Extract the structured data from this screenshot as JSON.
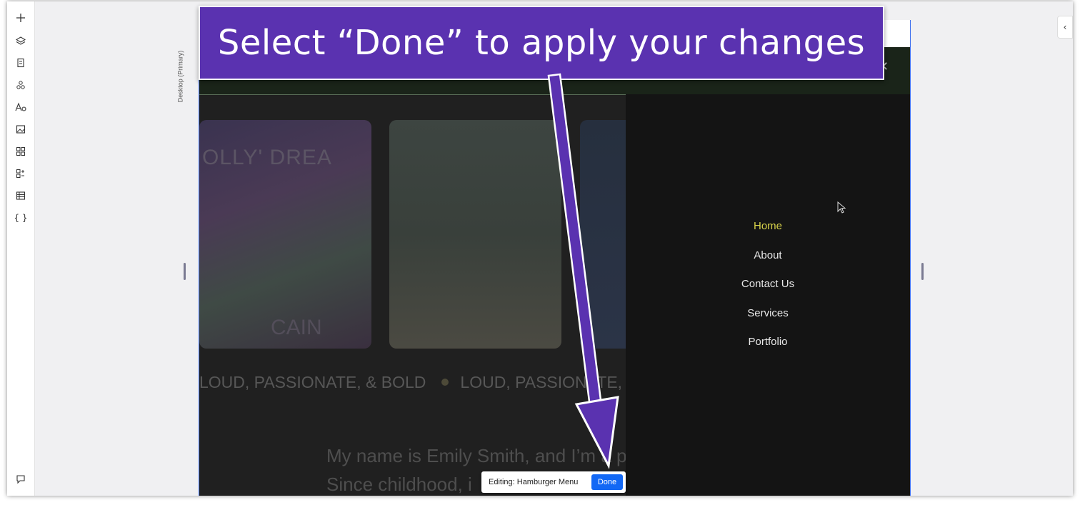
{
  "annotation": {
    "banner_text": "Select “Done” to apply your changes"
  },
  "editor": {
    "canvas_label": "Desktop (Primary)",
    "left_tools": [
      "add-icon",
      "layers-icon",
      "pages-icon",
      "apps-icon",
      "text-theme-icon",
      "media-icon",
      "widgets-icon",
      "business-apps-icon",
      "cms-table-icon",
      "code-icon"
    ],
    "edit_bar": {
      "label": "Editing: Hamburger Menu",
      "done_label": "Done"
    }
  },
  "site": {
    "ticker_text": "LOUD, PASSIONATE, & BOLD",
    "ticker_text_2": "LOUD, PASSIONATE,",
    "card1_top": "OLLY' DREA",
    "card1_bottom": "CAIN",
    "bio_line1": "My name is Emily Smith, and I’m a p",
    "bio_line2": "Since childhood, i"
  },
  "menu": {
    "items": [
      {
        "label": "Home",
        "active": true
      },
      {
        "label": "About",
        "active": false
      },
      {
        "label": "Contact Us",
        "active": false
      },
      {
        "label": "Services",
        "active": false
      },
      {
        "label": "Portfolio",
        "active": false
      }
    ]
  },
  "colors": {
    "banner": "#5a32b0",
    "done_button": "#1268f5",
    "active_menu": "#d8d34a"
  }
}
